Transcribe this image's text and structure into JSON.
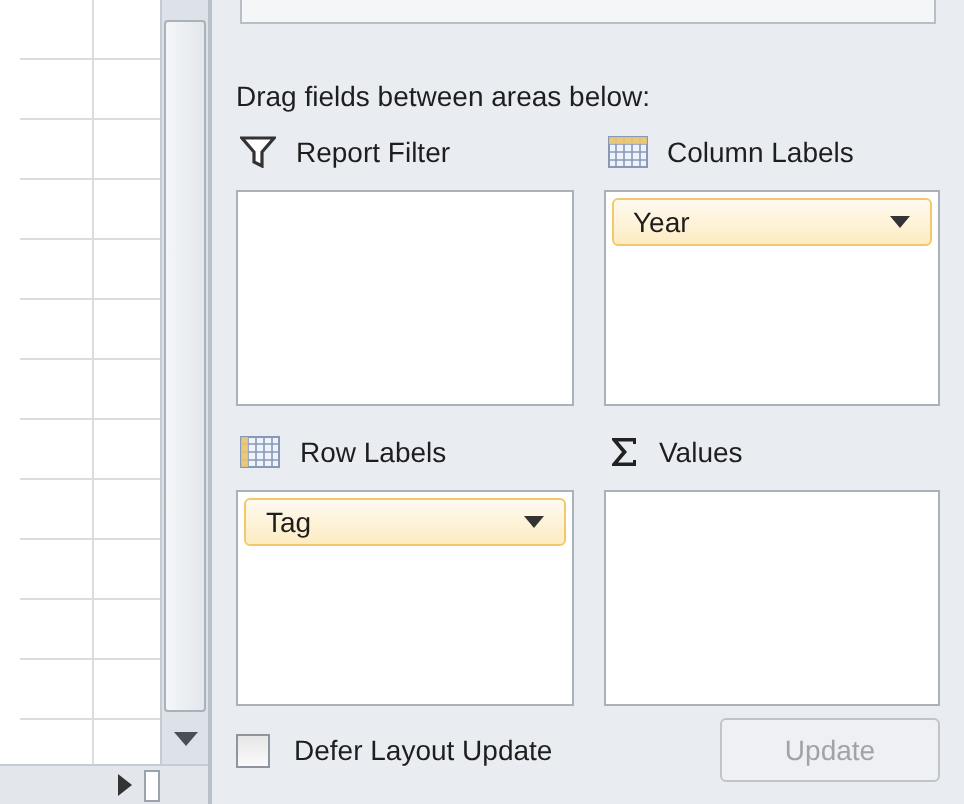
{
  "instruction": "Drag fields between areas below:",
  "areas": [
    {
      "kind": "filter",
      "title": "Report Filter"
    },
    {
      "kind": "columns",
      "title": "Column Labels",
      "fields": [
        {
          "label": "Year"
        }
      ]
    },
    {
      "kind": "rows",
      "title": "Row Labels",
      "fields": [
        {
          "label": "Tag"
        }
      ]
    },
    {
      "kind": "values",
      "title": "Values"
    }
  ],
  "defer_layout_update": {
    "label": "Defer Layout Update",
    "checked": false
  },
  "update_button": {
    "label": "Update",
    "disabled": true
  }
}
